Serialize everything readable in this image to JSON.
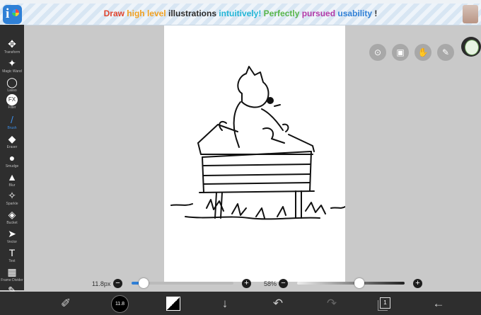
{
  "banner": {
    "parts": [
      {
        "text": "Draw ",
        "cls": "c-red"
      },
      {
        "text": "high level ",
        "cls": "c-orange"
      },
      {
        "text": "illustrations ",
        "cls": ""
      },
      {
        "text": "intuitively! ",
        "cls": "c-cyan"
      },
      {
        "text": "Perfectly ",
        "cls": "c-green"
      },
      {
        "text": "pursued ",
        "cls": "c-purple"
      },
      {
        "text": "usability ",
        "cls": "c-blue"
      },
      {
        "text": "!",
        "cls": ""
      }
    ]
  },
  "tools": [
    {
      "name": "transform",
      "label": "Transform",
      "icon": "✥",
      "active": false
    },
    {
      "name": "magic-wand",
      "label": "Magic Wand",
      "icon": "✦",
      "active": false
    },
    {
      "name": "lasso",
      "label": "Lasso",
      "icon": "◯",
      "active": false
    },
    {
      "name": "filter",
      "label": "Filter",
      "icon": "FX",
      "active": false
    },
    {
      "name": "brush",
      "label": "Brush",
      "icon": "/",
      "active": true
    },
    {
      "name": "eraser",
      "label": "Eraser",
      "icon": "◆",
      "active": false
    },
    {
      "name": "smudge",
      "label": "Smudge",
      "icon": "●",
      "active": false
    },
    {
      "name": "blur",
      "label": "Blur",
      "icon": "▲",
      "active": false
    },
    {
      "name": "sparkle",
      "label": "Sparkle",
      "icon": "✧",
      "active": false
    },
    {
      "name": "bucket",
      "label": "Bucket",
      "icon": "◈",
      "active": false
    },
    {
      "name": "vector",
      "label": "Vector",
      "icon": "➤",
      "active": false
    },
    {
      "name": "text",
      "label": "Text",
      "icon": "T",
      "active": false
    },
    {
      "name": "frame-divider",
      "label": "Frame Divider",
      "icon": "▦",
      "active": false
    },
    {
      "name": "eyedropper",
      "label": "",
      "icon": "✎",
      "active": false
    }
  ],
  "brush_size": {
    "label": "11.8px",
    "level": 0.12
  },
  "opacity": {
    "label": "58%",
    "level": 0.58
  },
  "bottom": {
    "brush_size_text": "11.8",
    "layer_count": "1"
  },
  "colors": {
    "accent": "#3d8ee6",
    "bar": "#2e2e2e"
  }
}
